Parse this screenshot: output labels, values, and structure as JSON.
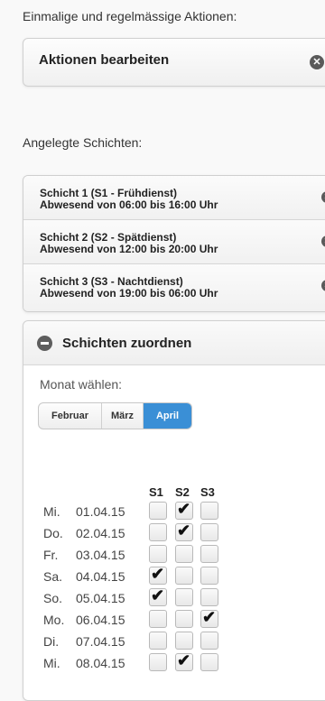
{
  "actions_label": "Einmalige und regelmässige Aktionen:",
  "actions_bar_title": "Aktionen bearbeiten",
  "shifts_label": "Angelegte Schichten:",
  "shifts": [
    {
      "line1": "Schicht 1 (S1 - Frühdienst)",
      "line2": "Abwesend von 06:00 bis 16:00 Uhr"
    },
    {
      "line1": "Schicht 2 (S2 - Spätdienst)",
      "line2": "Abwesend von 12:00 bis 20:00 Uhr"
    },
    {
      "line1": "Schicht 3 (S3 - Nachtdienst)",
      "line2": "Abwesend von 19:00 bis 06:00 Uhr"
    }
  ],
  "assign_panel": {
    "title": "Schichten zuordnen",
    "month_label": "Monat wählen:",
    "months": [
      "Februar",
      "März",
      "April"
    ],
    "selected_month": "April",
    "columns": [
      "S1",
      "S2",
      "S3"
    ],
    "rows": [
      {
        "day": "Mi.",
        "date": "01.04.15",
        "checks": [
          false,
          true,
          false
        ]
      },
      {
        "day": "Do.",
        "date": "02.04.15",
        "checks": [
          false,
          true,
          false
        ]
      },
      {
        "day": "Fr.",
        "date": "03.04.15",
        "checks": [
          false,
          false,
          false
        ]
      },
      {
        "day": "Sa.",
        "date": "04.04.15",
        "checks": [
          true,
          false,
          false
        ]
      },
      {
        "day": "So.",
        "date": "05.04.15",
        "checks": [
          true,
          false,
          false
        ]
      },
      {
        "day": "Mo.",
        "date": "06.04.15",
        "checks": [
          false,
          false,
          true
        ]
      },
      {
        "day": "Di.",
        "date": "07.04.15",
        "checks": [
          false,
          false,
          false
        ]
      },
      {
        "day": "Mi.",
        "date": "08.04.15",
        "checks": [
          false,
          true,
          false
        ]
      }
    ]
  },
  "icons": {
    "remove": "close-circle-icon",
    "collapse": "minus-circle-icon",
    "check": "checkmark-icon"
  },
  "colors": {
    "accent": "#3a8fd6",
    "icon": "#5a5a5a"
  }
}
